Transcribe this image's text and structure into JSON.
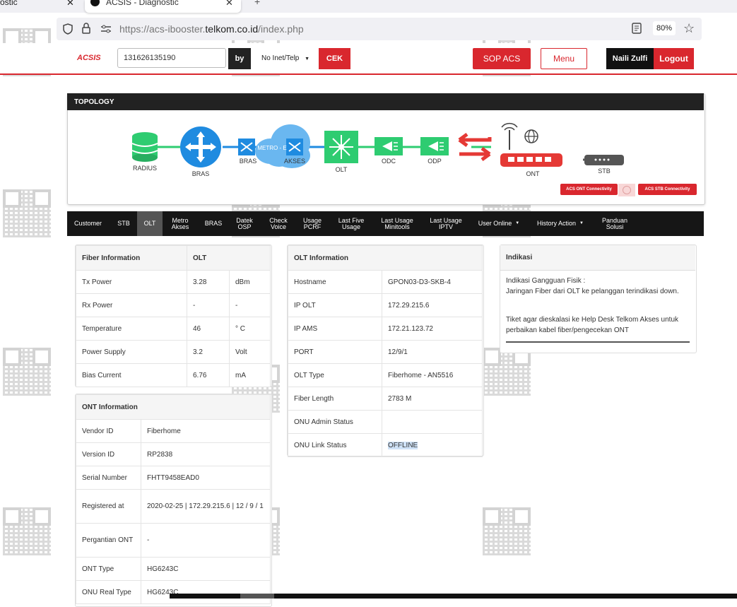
{
  "browser": {
    "prev_tab_title": "ostic",
    "active_tab_title": "ACSIS - Diagnostic",
    "url_prefix": "https://acs-ibooster.",
    "url_domain": "telkom.co.id",
    "url_path": "/index.php",
    "zoom": "80%"
  },
  "header": {
    "logo": "ACSIS",
    "search_value": "131626135190",
    "by_label": "by",
    "type_select": "No Inet/Telp",
    "cek_label": "CEK",
    "sop_label": "SOP ACS",
    "menu_label": "Menu",
    "user_name": "Naili Zulfi",
    "logout_label": "Logout"
  },
  "topology": {
    "title": "TOPOLOGY",
    "nodes": {
      "radius": "RADIUS",
      "bras": "BRAS",
      "bras2": "BRAS",
      "metro": "METRO - E",
      "akses": "AKSES",
      "olt": "OLT",
      "odc": "ODC",
      "odp": "ODP",
      "ont": "ONT",
      "stb": "STB"
    },
    "ont_connectivity": "ACS ONT Connectivity",
    "stb_connectivity": "ACS STB Connectivity"
  },
  "nav": {
    "items": [
      {
        "label": "Customer"
      },
      {
        "label": "STB"
      },
      {
        "label": "OLT"
      },
      {
        "label": "Metro Akses"
      },
      {
        "label": "BRAS"
      },
      {
        "label": "Datek OSP"
      },
      {
        "label": "Check Voice"
      },
      {
        "label": "Usage PCRF"
      },
      {
        "label": "Last Five Usage"
      },
      {
        "label": "Last Usage Minitools"
      },
      {
        "label": "Last Usage IPTV"
      },
      {
        "label": "User Online"
      },
      {
        "label": "History Action"
      },
      {
        "label": "Panduan Solusi"
      }
    ]
  },
  "fiber": {
    "title": "Fiber Information",
    "col2": "OLT",
    "rows": [
      {
        "label": "Tx Power",
        "value": "3.28",
        "unit": "dBm"
      },
      {
        "label": "Rx Power",
        "value": "-",
        "unit": "-"
      },
      {
        "label": "Temperature",
        "value": "46",
        "unit": "° C"
      },
      {
        "label": "Power Supply",
        "value": "3.2",
        "unit": "Volt"
      },
      {
        "label": "Bias Current",
        "value": "6.76",
        "unit": "mA"
      }
    ]
  },
  "olt_info": {
    "title": "OLT Information",
    "rows": [
      {
        "label": "Hostname",
        "value": "GPON03-D3-SKB-4"
      },
      {
        "label": "IP OLT",
        "value": "172.29.215.6"
      },
      {
        "label": "IP AMS",
        "value": "172.21.123.72"
      },
      {
        "label": "PORT",
        "value": "12/9/1"
      },
      {
        "label": "OLT Type",
        "value": "Fiberhome - AN5516"
      },
      {
        "label": "Fiber Length",
        "value": "2783 M"
      },
      {
        "label": "ONU Admin Status",
        "value": ""
      },
      {
        "label": "ONU Link Status",
        "value": "OFFLINE"
      }
    ]
  },
  "ont_info": {
    "title": "ONT Information",
    "rows": [
      {
        "label": "Vendor ID",
        "value": "Fiberhome"
      },
      {
        "label": "Version ID",
        "value": "RP2838"
      },
      {
        "label": "Serial Number",
        "value": "FHTT9458EAD0"
      },
      {
        "label": "Registered at",
        "value": "2020-02-25 | 172.29.215.6 | 12 / 9 / 1"
      },
      {
        "label": "Pergantian ONT",
        "value": "-"
      },
      {
        "label": "ONT Type",
        "value": "HG6243C"
      },
      {
        "label": "ONU Real Type",
        "value": "HG6243C"
      }
    ]
  },
  "indikasi": {
    "title": "Indikasi",
    "line1": "Indikasi Gangguan Fisik :",
    "line2": "Jaringan Fiber dari OLT ke pelanggan terindikasi down.",
    "line3": "Tiket agar dieskalasi ke Help Desk Telkom Akses untuk",
    "line4": "perbaikan kabel fiber/pengecekan ONT"
  },
  "colors": {
    "brand_red": "#d9272e",
    "node_blue": "#1f8be0",
    "node_green": "#2ecc71",
    "nav_dark": "#161616"
  }
}
